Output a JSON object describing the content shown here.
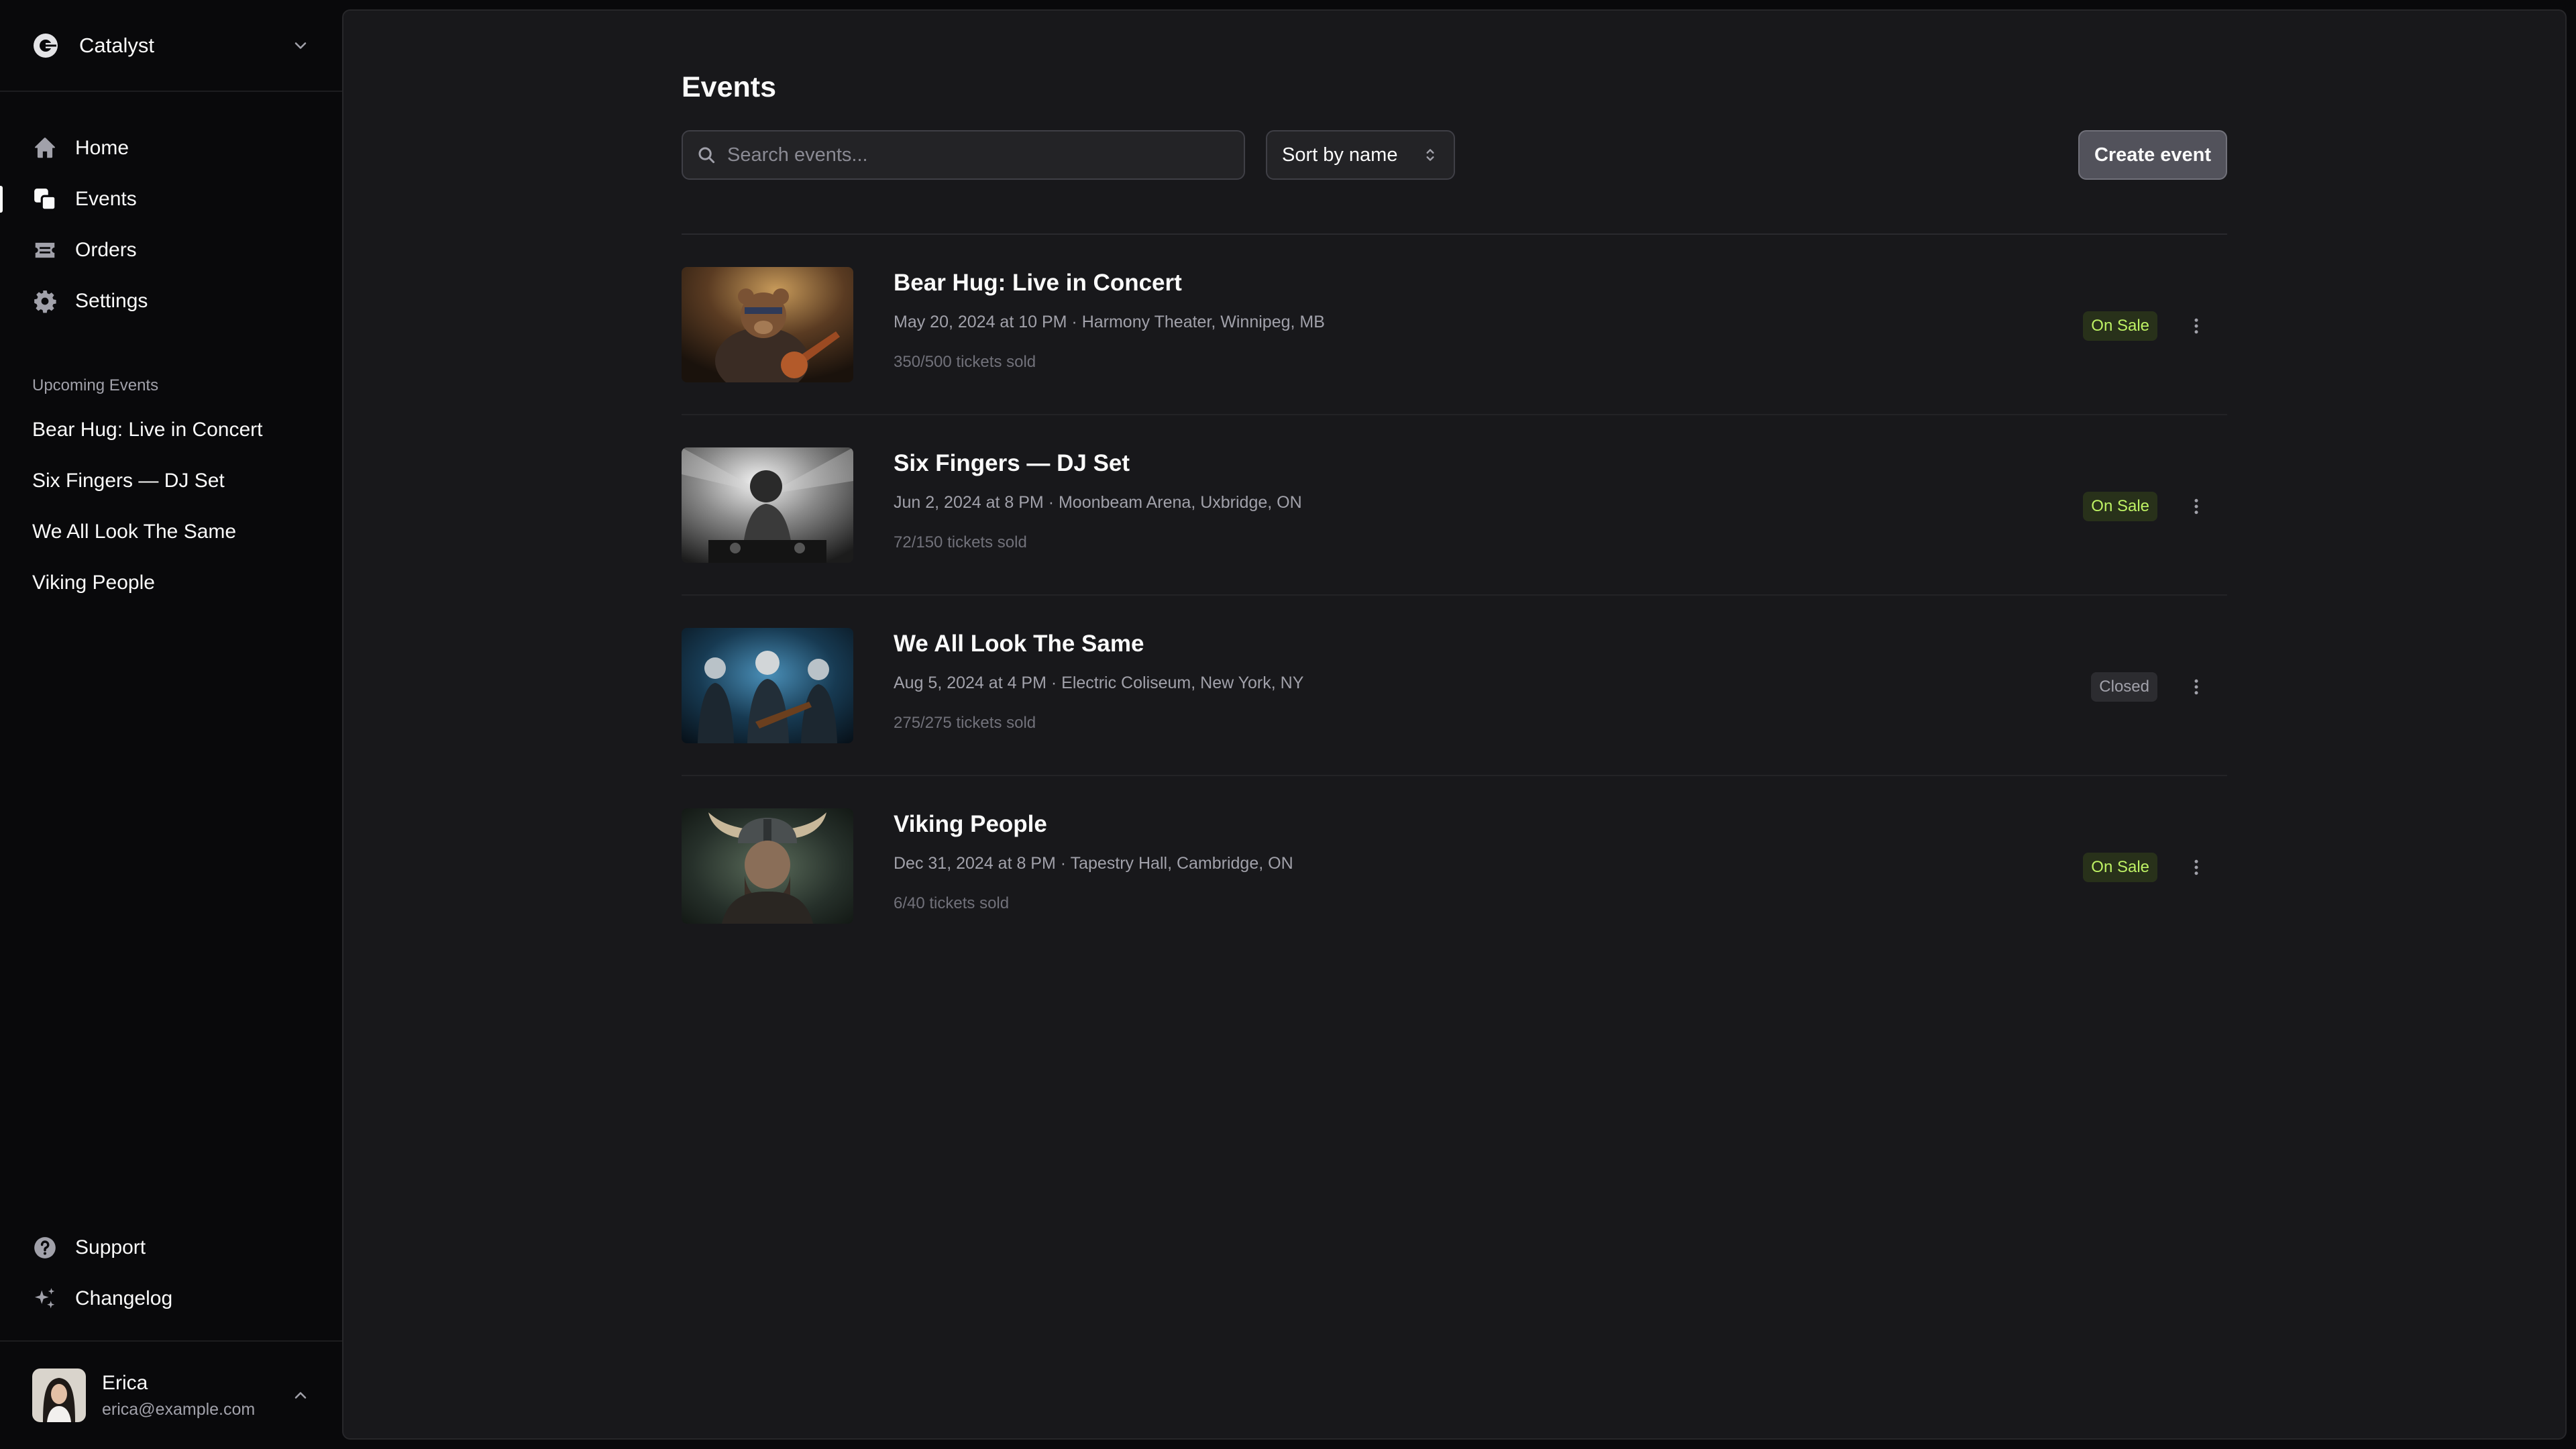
{
  "sidebar": {
    "team": {
      "name": "Catalyst",
      "logo_icon": "catalyst-logo-icon"
    },
    "nav": [
      {
        "label": "Home",
        "icon": "home-icon",
        "active": false
      },
      {
        "label": "Events",
        "icon": "squares-icon",
        "active": true
      },
      {
        "label": "Orders",
        "icon": "ticket-icon",
        "active": false
      },
      {
        "label": "Settings",
        "icon": "gear-icon",
        "active": false
      }
    ],
    "upcoming_heading": "Upcoming Events",
    "upcoming": [
      "Bear Hug: Live in Concert",
      "Six Fingers — DJ Set",
      "We All Look The Same",
      "Viking People"
    ],
    "bottom_nav": [
      {
        "label": "Support",
        "icon": "question-icon"
      },
      {
        "label": "Changelog",
        "icon": "sparkles-icon"
      }
    ],
    "user": {
      "name": "Erica",
      "email": "erica@example.com"
    }
  },
  "main": {
    "title": "Events",
    "search_placeholder": "Search events...",
    "sort_label": "Sort by name",
    "create_label": "Create event",
    "events": [
      {
        "title": "Bear Hug: Live in Concert",
        "meta": "May 20, 2024 at 10 PM · Harmony Theater, Winnipeg, MB",
        "sold": "350/500 tickets sold",
        "status": "On Sale"
      },
      {
        "title": "Six Fingers — DJ Set",
        "meta": "Jun 2, 2024 at 8 PM · Moonbeam Arena, Uxbridge, ON",
        "sold": "72/150 tickets sold",
        "status": "On Sale"
      },
      {
        "title": "We All Look The Same",
        "meta": "Aug 5, 2024 at 4 PM · Electric Coliseum, New York, NY",
        "sold": "275/275 tickets sold",
        "status": "Closed"
      },
      {
        "title": "Viking People",
        "meta": "Dec 31, 2024 at 8 PM · Tapestry Hall, Cambridge, ON",
        "sold": "6/40 tickets sold",
        "status": "On Sale"
      }
    ]
  },
  "colors": {
    "background": "#09090b",
    "panel": "#18181b",
    "on_sale_text": "#bef264",
    "on_sale_bg": "#28311a",
    "closed_bg": "#2c2c30"
  }
}
